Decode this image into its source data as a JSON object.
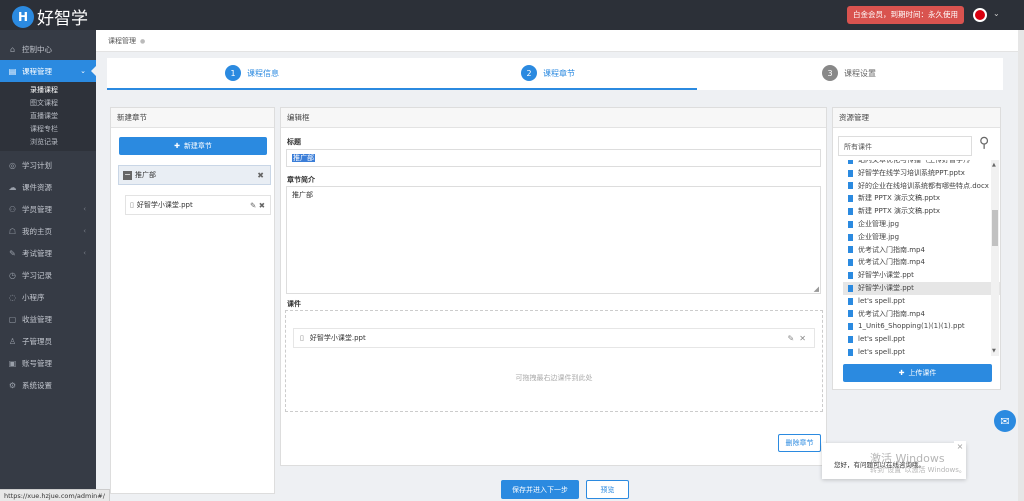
{
  "app": {
    "logo_letter": "H",
    "logo_text": "好智学"
  },
  "header": {
    "member_status": "白金会员，到期时间：永久使用"
  },
  "sidebar": {
    "items": [
      {
        "label": "控制中心",
        "icon": "home-icon"
      },
      {
        "label": "课程管理",
        "icon": "book-icon",
        "active": true
      },
      {
        "label": "学习计划",
        "icon": "plan-icon"
      },
      {
        "label": "课件资源",
        "icon": "cloud-icon"
      },
      {
        "label": "学员管理",
        "icon": "users-icon"
      },
      {
        "label": "我的主页",
        "icon": "homepage-icon"
      },
      {
        "label": "考试管理",
        "icon": "exam-icon"
      },
      {
        "label": "学习记录",
        "icon": "record-icon"
      },
      {
        "label": "小程序",
        "icon": "miniprogram-icon"
      },
      {
        "label": "收益管理",
        "icon": "income-icon"
      },
      {
        "label": "子管理员",
        "icon": "subadmin-icon"
      },
      {
        "label": "账号管理",
        "icon": "account-icon"
      },
      {
        "label": "系统设置",
        "icon": "settings-icon"
      }
    ],
    "sub_items": [
      "录播课程",
      "图文课程",
      "直播课堂",
      "课程专栏",
      "浏览记录"
    ]
  },
  "status_url": "https://xue.hzjue.com/admin#/",
  "breadcrumb": {
    "current": "课程管理"
  },
  "steps": [
    {
      "num": "1",
      "label": "课程信息",
      "state": "done"
    },
    {
      "num": "2",
      "label": "课程章节",
      "state": "active"
    },
    {
      "num": "3",
      "label": "课程设置",
      "state": "todo"
    }
  ],
  "chapters": {
    "title": "新建章节",
    "new_button": "新建章节",
    "chapter_name": "推广部",
    "files": [
      "好智学小课堂.ppt"
    ]
  },
  "editor": {
    "title": "编辑框",
    "title_label": "标题",
    "title_value": "推广部",
    "intro_label": "章节简介",
    "intro_value": "推广部",
    "courseware_label": "课件",
    "courseware_file": "好智学小课堂.ppt",
    "drop_hint": "可拖拽最右边课件到此处",
    "delete_button": "删除章节"
  },
  "resources": {
    "title": "资源管理",
    "search_placeholder": "所有课件",
    "items": [
      "站内文章优化与传播（上传好智学）》",
      "好智学在线学习培训系统PPT.pptx",
      "好的企业在线培训系统都有哪些特点.docx",
      "新建 PPTX 演示文稿.pptx",
      "新建 PPTX 演示文稿.pptx",
      "企业管理.jpg",
      "企业管理.jpg",
      "优考试入门指南.mp4",
      "优考试入门指南.mp4",
      "好智学小课堂.ppt",
      "好智学小课堂.ppt",
      "let's spell.ppt",
      "优考试入门指南.mp4",
      "1_Unit6_Shopping(1)(1)(1).ppt",
      "let's spell.ppt",
      "let's spell.ppt"
    ],
    "highlighted_index": 10,
    "upload_button": "上传课件"
  },
  "footer": {
    "save_next": "保存并进入下一步",
    "preview": "预览"
  },
  "toast": {
    "text": "您好，有问题可以在线咨询哦。"
  },
  "windows_watermark": {
    "line1": "激活 Windows",
    "line2": "转到\"设置\"以激活 Windows。"
  },
  "colors": {
    "primary": "#2b8ae0",
    "sidebar": "#363b45",
    "header": "#2c3038",
    "badge": "#d9534f"
  }
}
